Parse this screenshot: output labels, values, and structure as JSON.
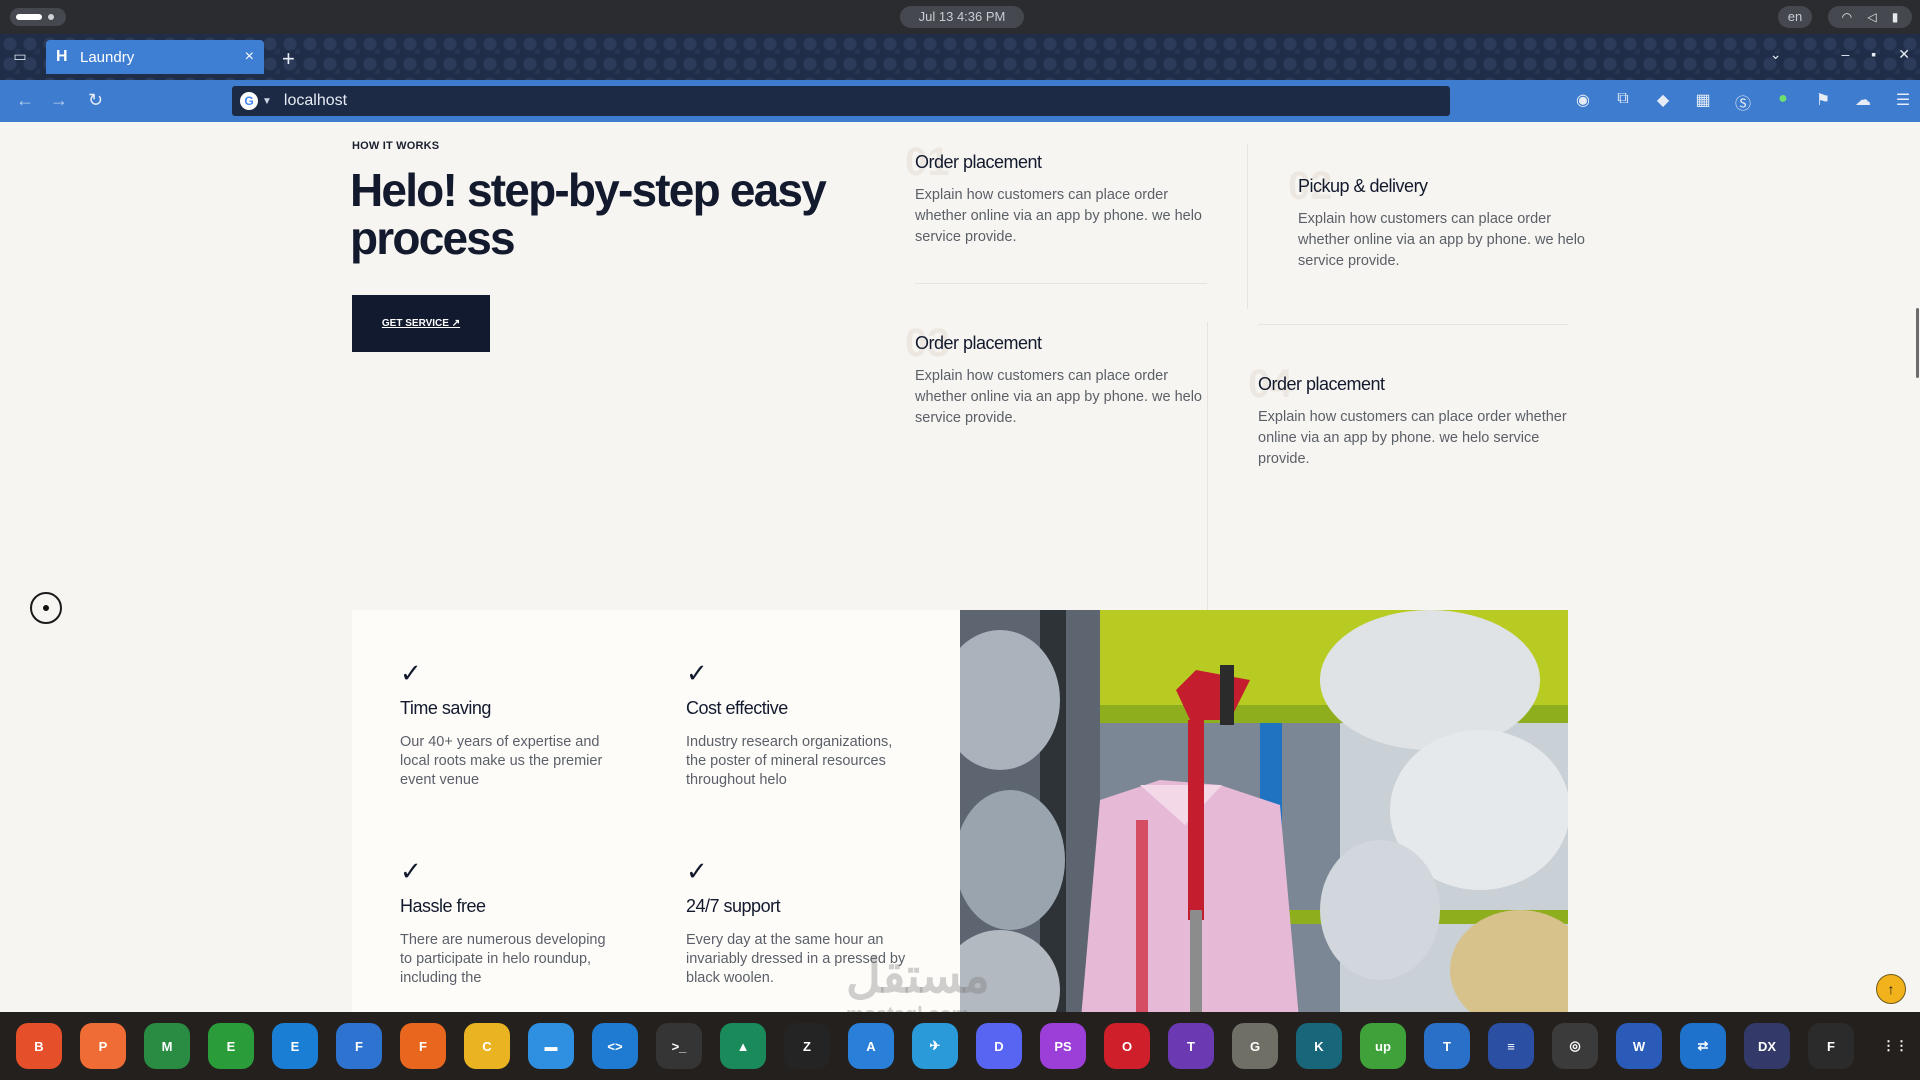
{
  "os": {
    "clock": "Jul 13    4:36 PM",
    "language": "en",
    "status_icons": [
      "wifi-icon",
      "volume-icon",
      "battery-icon"
    ]
  },
  "browser": {
    "tab_title": "Laundry",
    "tab_favicon": "H",
    "url": "localhost",
    "extensions": [
      "profile-icon",
      "puzzle-icon",
      "vpn-icon",
      "apps-icon",
      "s-icon",
      "green-icon",
      "flag-icon",
      "cloud-icon",
      "menu-icon"
    ]
  },
  "page": {
    "eyebrow": "HOW IT WORKS",
    "hero_title": "Helo! step-by-step easy process",
    "cta_label": "GET SERVICE ↗",
    "steps": [
      {
        "num": "01",
        "title": "Order placement",
        "desc": "Explain how customers can place order whether online via an app by phone. we helo service provide."
      },
      {
        "num": "02",
        "title": "Pickup & delivery",
        "desc": "Explain how customers can place order whether online via an app by phone. we helo service provide."
      },
      {
        "num": "03",
        "title": "Order placement",
        "desc": "Explain how customers can place order whether online via an app by phone. we helo service provide."
      },
      {
        "num": "04",
        "title": "Order placement",
        "desc": "Explain how customers can place order whether online via an app by phone. we helo service provide."
      }
    ],
    "features": [
      {
        "title": "Time saving",
        "desc": "Our 40+ years of expertise and local roots make us the premier event venue"
      },
      {
        "title": "Cost effective",
        "desc": "Industry research organizations, the poster of mineral resources throughout helo"
      },
      {
        "title": "Hassle free",
        "desc": "There are numerous developing to participate in helo roundup, including the"
      },
      {
        "title": "24/7 support",
        "desc": "Every day at the same hour an invariably dressed in a pressed by black woolen."
      }
    ],
    "to_top": "↑"
  },
  "watermark": {
    "line1": "مستقل",
    "line2": "mostaql.com"
  },
  "dock": [
    {
      "name": "brave-icon",
      "color": "#e5502a",
      "label": "B"
    },
    {
      "name": "postman-icon",
      "color": "#ef6c35",
      "label": "P"
    },
    {
      "name": "mongodb-icon",
      "color": "#2a8c43",
      "label": "M"
    },
    {
      "name": "edge-green-icon",
      "color": "#2b9c3a",
      "label": "E"
    },
    {
      "name": "edge-icon",
      "color": "#1a7fd4",
      "label": "E"
    },
    {
      "name": "firefox-dev-icon",
      "color": "#2e73cf",
      "label": "F"
    },
    {
      "name": "firefox-icon",
      "color": "#e8661e",
      "label": "F"
    },
    {
      "name": "chrome-icon",
      "color": "#e9b321",
      "label": "C"
    },
    {
      "name": "files-icon",
      "color": "#2f8fe0",
      "label": "▬"
    },
    {
      "name": "vscode-icon",
      "color": "#1f7bd1",
      "label": "<>"
    },
    {
      "name": "terminal-icon",
      "color": "#353535",
      "label": ">_"
    },
    {
      "name": "monitor-icon",
      "color": "#1a8a5a",
      "label": "▲"
    },
    {
      "name": "zed-icon",
      "color": "#242424",
      "label": "Z"
    },
    {
      "name": "appstore-icon",
      "color": "#2a7fd8",
      "label": "A"
    },
    {
      "name": "telegram-icon",
      "color": "#2a9ad8",
      "label": "✈"
    },
    {
      "name": "discord-icon",
      "color": "#5865f2",
      "label": "D"
    },
    {
      "name": "phpstorm-icon",
      "color": "#9b3fd8",
      "label": "PS"
    },
    {
      "name": "opera-icon",
      "color": "#cf1f2a",
      "label": "O"
    },
    {
      "name": "tor-icon",
      "color": "#6b3ab3",
      "label": "T"
    },
    {
      "name": "gimp-icon",
      "color": "#6f6f66",
      "label": "G"
    },
    {
      "name": "gitkraken-icon",
      "color": "#17667a",
      "label": "K"
    },
    {
      "name": "upwork-icon",
      "color": "#3fa13a",
      "label": "up"
    },
    {
      "name": "thunderbird-icon",
      "color": "#2a6fc8",
      "label": "T"
    },
    {
      "name": "settings-icon",
      "color": "#2b4fa3",
      "label": "≡"
    },
    {
      "name": "obs-icon",
      "color": "#3b3b3b",
      "label": "◎"
    },
    {
      "name": "wps-icon",
      "color": "#2a5bb8",
      "label": "W"
    },
    {
      "name": "teamviewer-icon",
      "color": "#1e72cc",
      "label": "⇄"
    },
    {
      "name": "ardx-icon",
      "color": "#333a6a",
      "label": "DX"
    },
    {
      "name": "figma-icon",
      "color": "#2b2b2b",
      "label": "F"
    },
    {
      "name": "app-grid-icon",
      "color": "#23201d",
      "label": "⋮⋮"
    }
  ]
}
